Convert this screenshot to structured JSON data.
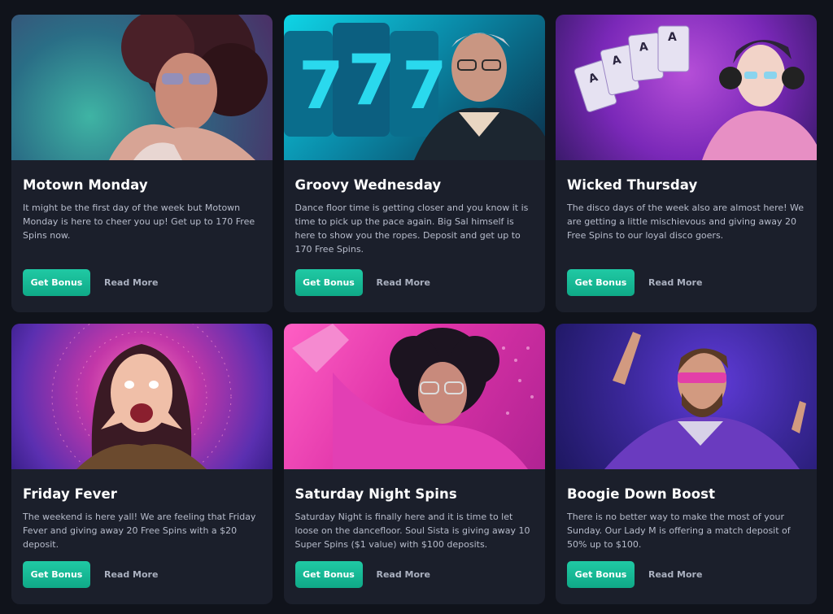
{
  "cards": [
    {
      "title": "Motown Monday",
      "description": "It might be the first day of the week but Motown Monday is here to cheer you up! Get up to 170 Free Spins now.",
      "button_label": "Get Bonus",
      "link_label": "Read More",
      "image": "disco-woman-afro-sunglasses"
    },
    {
      "title": "Groovy Wednesday",
      "description": "Dance floor time is getting closer and you know it is time to pick up the pace again. Big Sal himself is here to show you the ropes. Deposit and get up to 170 Free Spins.",
      "button_label": "Get Bonus",
      "link_label": "Read More",
      "image": "man-with-777-slot-reels"
    },
    {
      "title": "Wicked Thursday",
      "description": "The disco days of the week also are almost here! We are getting a little mischievous and giving away 20 Free Spins to our loyal disco goers.",
      "button_label": "Get Bonus",
      "link_label": "Read More",
      "image": "woman-headphones-playing-cards"
    },
    {
      "title": "Friday Fever",
      "description": "The weekend is here yall! We are feeling that Friday Fever and giving away 20 Free Spins with a $20 deposit.",
      "button_label": "Get Bonus",
      "link_label": "Read More",
      "image": "excited-woman-pink-background"
    },
    {
      "title": "Saturday Night Spins",
      "description": "Saturday Night is finally here and it is time to let loose on the dancefloor. Soul Sista is giving away 10 Super Spins ($1 value) with $100 deposits.",
      "button_label": "Get Bonus",
      "link_label": "Read More",
      "image": "dancing-woman-afro-pink"
    },
    {
      "title": "Boogie Down Boost",
      "description": "There is no better way to make the most of your Sunday. Our Lady M is offering a match deposit of 50% up to $100.",
      "button_label": "Get Bonus",
      "link_label": "Read More",
      "image": "bearded-man-pointing-up"
    }
  ],
  "colors": {
    "page_background": "#10131b",
    "card_background": "#1b1f2b",
    "accent": "#14b894",
    "title_text": "#ffffff",
    "body_text": "#b7bccb"
  }
}
